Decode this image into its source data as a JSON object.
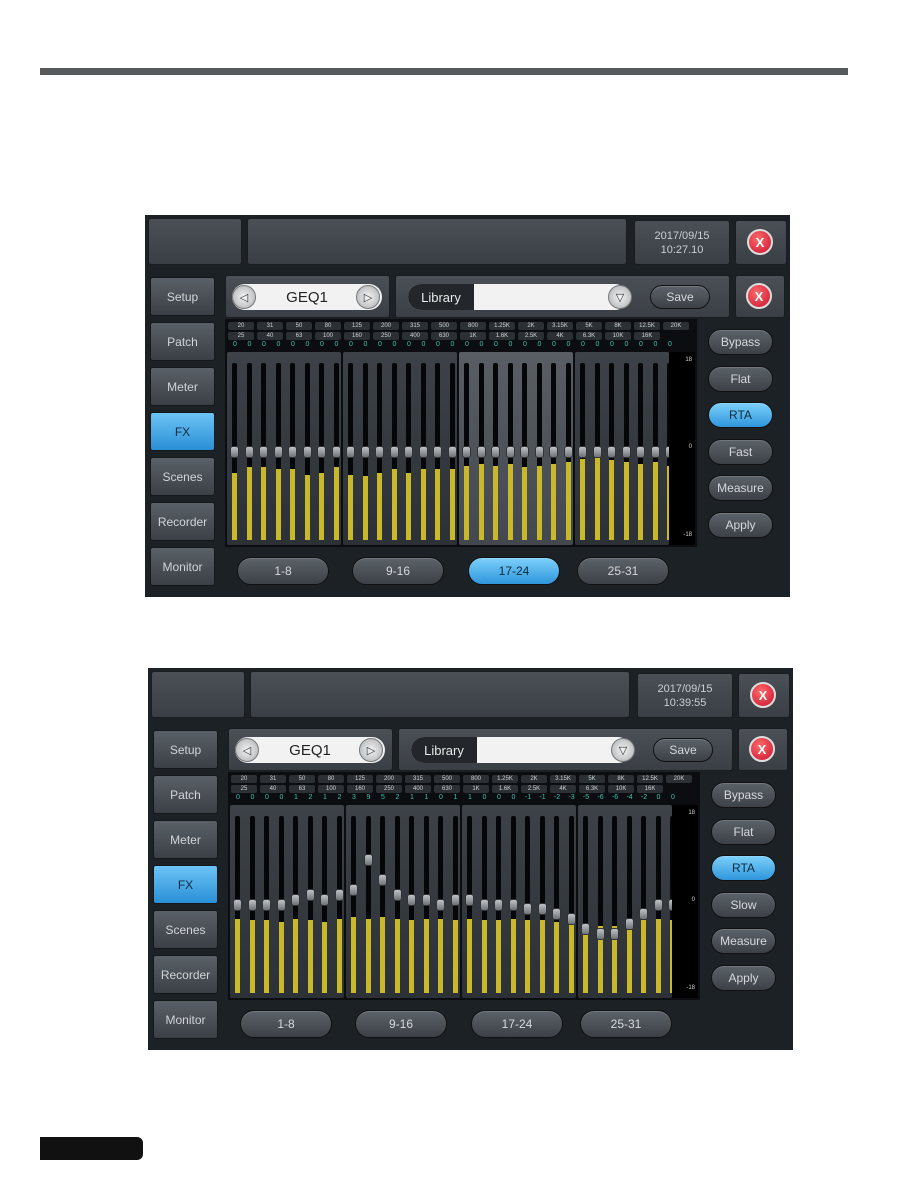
{
  "screens": [
    {
      "date": "2017/09/15",
      "time": "10:27.10",
      "close_label": "X",
      "preset_name": "GEQ1",
      "prev_icon": "◁",
      "next_icon": "▷",
      "library_label": "Library",
      "library_value": "",
      "dropdown_icon": "▽",
      "save_label": "Save",
      "nav": [
        "Setup",
        "Patch",
        "Meter",
        "FX",
        "Scenes",
        "Recorder",
        "Monitor"
      ],
      "active_nav": "FX",
      "freq_top": [
        "20",
        "31",
        "50",
        "80",
        "125",
        "200",
        "315",
        "500",
        "800",
        "1.25K",
        "2K",
        "3.15K",
        "5K",
        "8K",
        "12.5K",
        "20K"
      ],
      "freq_bottom": [
        "25",
        "40",
        "63",
        "100",
        "160",
        "250",
        "400",
        "630",
        "1K",
        "1.6K",
        "2.5K",
        "4K",
        "6.3K",
        "10K",
        "16K"
      ],
      "gains": [
        "0",
        "0",
        "0",
        "0",
        "0",
        "0",
        "0",
        "0",
        "0",
        "0",
        "0",
        "0",
        "0",
        "0",
        "0",
        "0",
        "0",
        "0",
        "0",
        "0",
        "0",
        "0",
        "0",
        "0",
        "0",
        "0",
        "0",
        "0",
        "0",
        "0",
        "0"
      ],
      "rta_levels": [
        0.38,
        0.41,
        0.41,
        0.4,
        0.4,
        0.37,
        0.38,
        0.41,
        0.37,
        0.36,
        0.38,
        0.4,
        0.38,
        0.4,
        0.4,
        0.4,
        0.42,
        0.43,
        0.42,
        0.43,
        0.41,
        0.42,
        0.43,
        0.44,
        0.46,
        0.47,
        0.45,
        0.44,
        0.43,
        0.44,
        0.42
      ],
      "scale": [
        "18",
        "0",
        "-18"
      ],
      "side_buttons": [
        "Bypass",
        "Flat",
        "RTA",
        "Fast",
        "Measure",
        "Apply"
      ],
      "active_side": "RTA",
      "groups": [
        "1-8",
        "9-16",
        "17-24",
        "25-31"
      ],
      "active_group": "17-24"
    },
    {
      "date": "2017/09/15",
      "time": "10:39:55",
      "close_label": "X",
      "preset_name": "GEQ1",
      "prev_icon": "◁",
      "next_icon": "▷",
      "library_label": "Library",
      "library_value": "",
      "dropdown_icon": "▽",
      "save_label": "Save",
      "nav": [
        "Setup",
        "Patch",
        "Meter",
        "FX",
        "Scenes",
        "Recorder",
        "Monitor"
      ],
      "active_nav": "FX",
      "freq_top": [
        "20",
        "31",
        "50",
        "80",
        "125",
        "200",
        "315",
        "500",
        "800",
        "1.25K",
        "2K",
        "3.15K",
        "5K",
        "8K",
        "12.5K",
        "20K"
      ],
      "freq_bottom": [
        "25",
        "40",
        "63",
        "100",
        "160",
        "250",
        "400",
        "630",
        "1K",
        "1.6K",
        "2.5K",
        "4K",
        "6.3K",
        "10K",
        "16K"
      ],
      "gains": [
        "0",
        "0",
        "0",
        "0",
        "1",
        "2",
        "1",
        "2",
        "3",
        "9",
        "5",
        "2",
        "1",
        "1",
        "0",
        "1",
        "1",
        "0",
        "0",
        "0",
        "-1",
        "-1",
        "-2",
        "-3",
        "-5",
        "-6",
        "-6",
        "-4",
        "-2",
        "0",
        "0"
      ],
      "rta_levels": [
        0.42,
        0.41,
        0.41,
        0.4,
        0.42,
        0.41,
        0.4,
        0.42,
        0.43,
        0.42,
        0.43,
        0.42,
        0.41,
        0.42,
        0.42,
        0.41,
        0.42,
        0.41,
        0.41,
        0.42,
        0.41,
        0.41,
        0.4,
        0.4,
        0.39,
        0.38,
        0.38,
        0.4,
        0.41,
        0.42,
        0.41
      ],
      "scale": [
        "18",
        "0",
        "-18"
      ],
      "side_buttons": [
        "Bypass",
        "Flat",
        "RTA",
        "Slow",
        "Measure",
        "Apply"
      ],
      "active_side": "RTA",
      "groups": [
        "1-8",
        "9-16",
        "17-24",
        "25-31"
      ],
      "active_group": null
    }
  ]
}
